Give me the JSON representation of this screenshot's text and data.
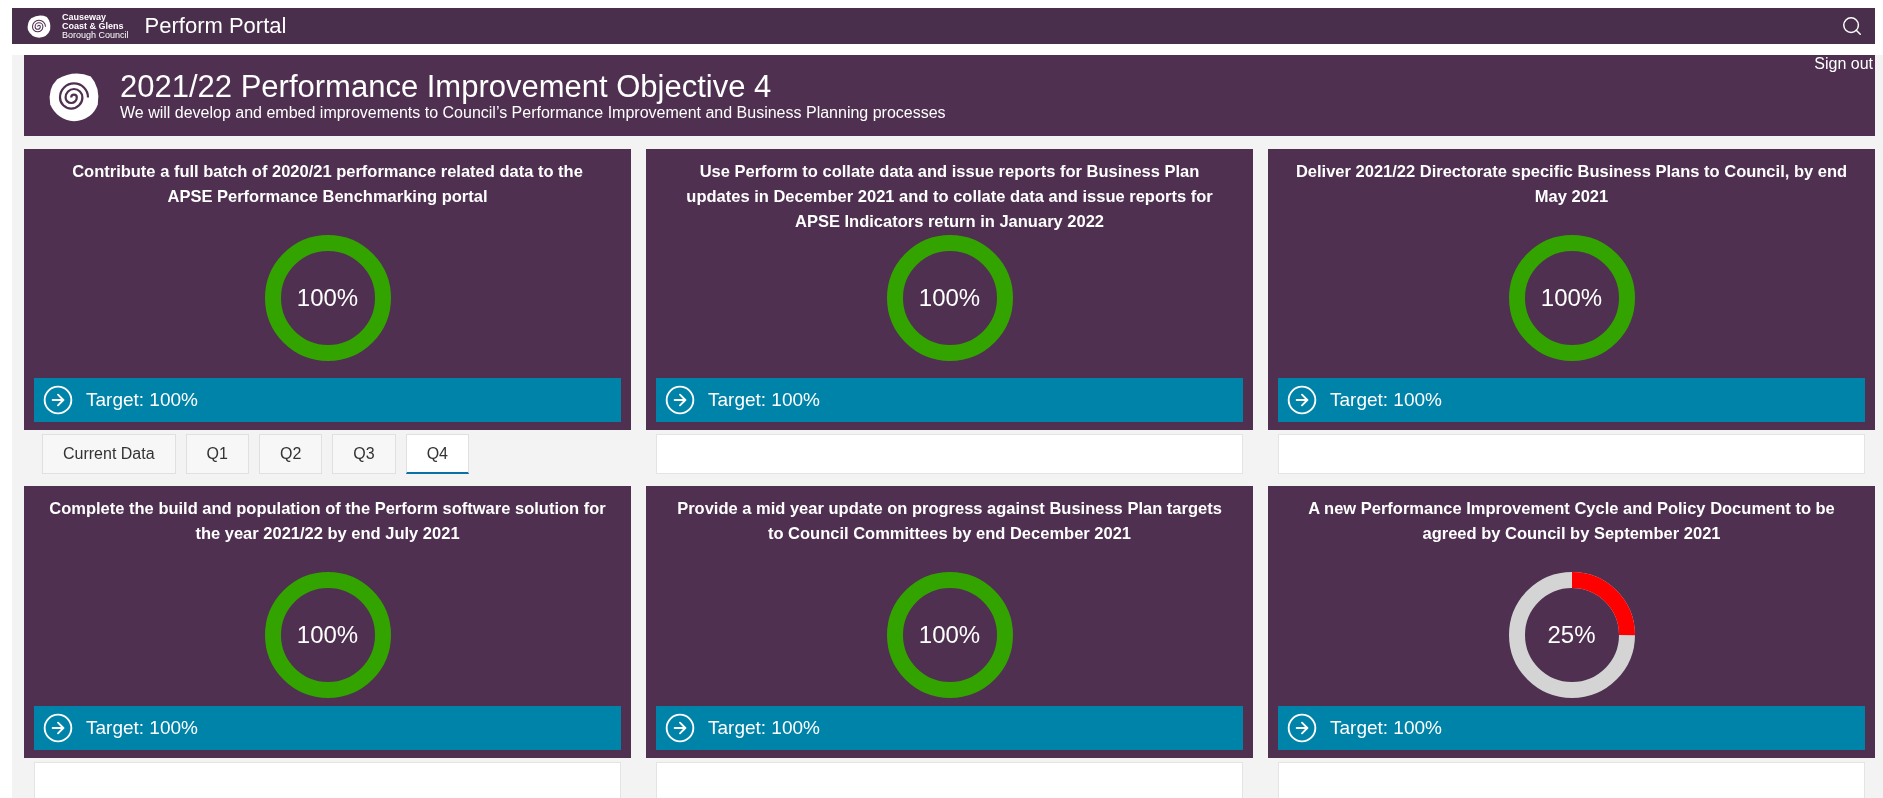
{
  "top_bar": {
    "logo_lines": [
      "Causeway",
      "Coast & Glens",
      "Borough Council"
    ],
    "title": "Perform Portal"
  },
  "header": {
    "title": "2021/22 Performance Improvement Objective 4",
    "subtitle": "We will develop and embed improvements to Council’s Performance Improvement and Business Planning processes",
    "sign_out": "Sign out"
  },
  "objectives": [
    {
      "title": "Contribute a full batch of 2020/21 performance related data to the APSE Performance Benchmarking portal",
      "progress": "100%",
      "color": "#33a300",
      "target": "Target: 100%"
    },
    {
      "title": "Use Perform to collate data and issue reports for Business Plan updates in December 2021 and to collate data and issue reports for APSE Indicators return in January 2022",
      "progress": "100%",
      "color": "#33a300",
      "target": "Target: 100%"
    },
    {
      "title": "Deliver 2021/22 Directorate specific Business Plans to Council, by end May 2021",
      "progress": "100%",
      "color": "#33a300",
      "target": "Target: 100%"
    },
    {
      "title": "Complete the build and population of the Perform software solution for the year 2021/22 by end July 2021",
      "progress": "100%",
      "color": "#33a300",
      "target": "Target: 100%"
    },
    {
      "title": "Provide a mid year update on progress against Business Plan targets to Council Committees by end December 2021",
      "progress": "100%",
      "color": "#33a300",
      "target": "Target: 100%"
    },
    {
      "title": "A new Performance Improvement Cycle and Policy Document to be agreed by Council by September 2021",
      "progress": "25%",
      "color": "#ff0000",
      "target": "Target: 100%"
    }
  ],
  "period_tabs": [
    {
      "label": "Current Data",
      "selected": false
    },
    {
      "label": "Q1",
      "selected": false
    },
    {
      "label": "Q2",
      "selected": false
    },
    {
      "label": "Q3",
      "selected": false
    },
    {
      "label": "Q4",
      "selected": true
    }
  ]
}
